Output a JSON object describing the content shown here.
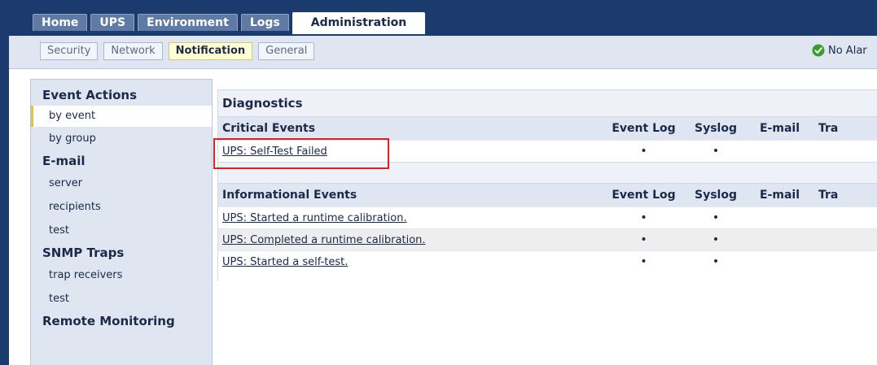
{
  "main_tabs": [
    {
      "label": "Home",
      "active": false
    },
    {
      "label": "UPS",
      "active": false
    },
    {
      "label": "Environment",
      "active": false
    },
    {
      "label": "Logs",
      "active": false
    },
    {
      "label": "Administration",
      "active": true
    }
  ],
  "sub_tabs": [
    {
      "label": "Security",
      "active": false
    },
    {
      "label": "Network",
      "active": false
    },
    {
      "label": "Notification",
      "active": true
    },
    {
      "label": "General",
      "active": false
    }
  ],
  "status": {
    "text": "No Alar",
    "icon": "check-circle-icon",
    "color": "#3a9b2e"
  },
  "sidenav": {
    "groups": [
      {
        "label": "Event Actions",
        "items": [
          {
            "label": "by event",
            "active": true
          },
          {
            "label": "by group",
            "active": false
          }
        ]
      },
      {
        "label": "E-mail",
        "items": [
          {
            "label": "server",
            "active": false
          },
          {
            "label": "recipients",
            "active": false
          },
          {
            "label": "test",
            "active": false
          }
        ]
      },
      {
        "label": "SNMP Traps",
        "items": [
          {
            "label": "trap receivers",
            "active": false
          },
          {
            "label": "test",
            "active": false
          }
        ]
      },
      {
        "label": "Remote Monitoring",
        "items": []
      }
    ]
  },
  "panel": {
    "title": "Diagnostics",
    "columns": [
      "Event Log",
      "Syslog",
      "E-mail",
      "Tra"
    ],
    "critical": {
      "heading": "Critical Events",
      "rows": [
        {
          "event": "UPS: Self-Test Failed",
          "event_log": "•",
          "syslog": "•",
          "email": "",
          "trap": ""
        }
      ]
    },
    "informational": {
      "heading": "Informational Events",
      "rows": [
        {
          "event": "UPS: Started a runtime calibration.",
          "event_log": "•",
          "syslog": "•",
          "email": "",
          "trap": ""
        },
        {
          "event": "UPS: Completed a runtime calibration.",
          "event_log": "•",
          "syslog": "•",
          "email": "",
          "trap": ""
        },
        {
          "event": "UPS: Started a self-test.",
          "event_log": "•",
          "syslog": "•",
          "email": "",
          "trap": ""
        }
      ]
    }
  },
  "colors": {
    "navy": "#1b3a6e",
    "highlight": "#e02020"
  }
}
